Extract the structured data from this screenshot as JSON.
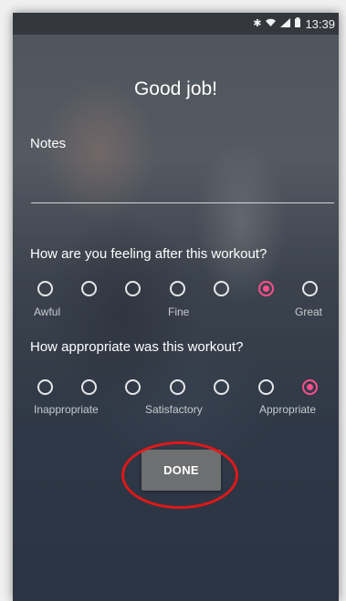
{
  "status_bar": {
    "time": "13:39",
    "icons": [
      "bluetooth-icon",
      "wifi-icon",
      "signal-icon",
      "battery-icon"
    ]
  },
  "title": "Good job!",
  "notes": {
    "label": "Notes",
    "value": "",
    "placeholder": ""
  },
  "feeling": {
    "question": "How are you feeling after this workout?",
    "options_count": 7,
    "selected_index": 5,
    "labels": {
      "low": "Awful",
      "mid": "Fine",
      "high": "Great"
    }
  },
  "appropriateness": {
    "question": "How appropriate was this workout?",
    "options_count": 7,
    "selected_index": 6,
    "labels": {
      "low": "Inappropriate",
      "mid": "Satisfactory",
      "high": "Appropriate"
    }
  },
  "done_button": {
    "label": "DONE"
  },
  "colors": {
    "accent": "#ff4f8b",
    "annotation": "#e01818",
    "button": "#6e6f71"
  }
}
